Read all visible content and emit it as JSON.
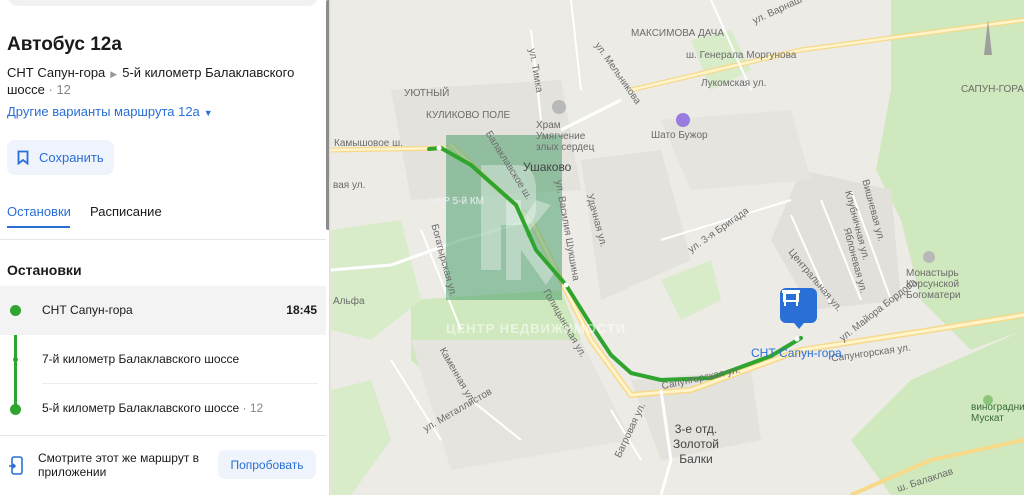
{
  "route": {
    "title": "Автобус 12а",
    "from": "СНТ Сапун-гора",
    "to": "5-й километр Балаклавского шоссе",
    "to_number": "· 12",
    "variants_link": "Другие варианты маршрута 12а",
    "save_label": "Сохранить"
  },
  "tabs": [
    {
      "label": "Остановки",
      "active": true
    },
    {
      "label": "Расписание",
      "active": false
    }
  ],
  "stops_section_title": "Остановки",
  "stops": [
    {
      "name": "СНТ Сапун-гора",
      "time": "18:45",
      "extra": ""
    },
    {
      "name": "7-й километр Балаклавского шоссе",
      "time": "",
      "extra": ""
    },
    {
      "name": "5-й километр Балаклавского шоссе",
      "time": "",
      "extra": "· 12"
    }
  ],
  "promo": {
    "text": "Смотрите этот же маршрут в приложении",
    "button": "Попробовать"
  },
  "map": {
    "labels": {
      "maksimova_dacha": "МАКСИМОВА ДАЧА",
      "gen_morgunova": "ш. Генерала Моргунова",
      "lukomskaya": "Лукомская ул.",
      "melnikova": "ул. Мельникова",
      "timka": "ул. Тимка",
      "utyuzhny": "УЮТНЫЙ",
      "kulikovo": "КУЛИКОВО ПОЛЕ",
      "hram": "Храм Умягчение злых сердец",
      "shato": "Шато Бужор",
      "kamyshovoe": "Камышовое ш.",
      "balaklavskoe": "Балаклавское ш.",
      "ushakovo": "Ушаково",
      "mkr": "МКР 5-й КМ",
      "bogatyrskaya": "Богатырская ул.",
      "alfa": "Альфа",
      "golikovskaya": "Голицынская ул.",
      "vasiliya_shukshina": "ул. Василия Шукшина",
      "udachnaya": "Удачная ул.",
      "brigada": "ул. 3-я Бригада",
      "vishnevaya": "Вишневая ул.",
      "klubnichnaya": "Клубничная ул.",
      "yablonevaya": "Яблоневая ул.",
      "centralnaya": "Центральная ул.",
      "maiora_bordova": "ул. Майора Бордова",
      "sapungorskaya": "Сапунгорская ул.",
      "monastyr": "Монастырь Корсунской Богоматери",
      "sapun_gora": "САПУН-ГОРА",
      "kamennaya": "Каменная ул.",
      "metallistov": "ул. Металлистов",
      "bagrovaya": "Багровая ул.",
      "zolotoy_balki": "3-е отд. Золотой Балки",
      "vinogradniki": "виноградники Мускат",
      "balaklav_bottom": "ш. Балаклав",
      "vaya_ul": "вая ул.",
      "varnaya": "ул. Варнаш"
    },
    "stop_label": "СНТ Сапун-гора",
    "watermark": "ЦЕНТР НЕДВИЖИМОСТИ",
    "route_color": "#2fa52f",
    "marker_color": "#2a6fd6"
  }
}
